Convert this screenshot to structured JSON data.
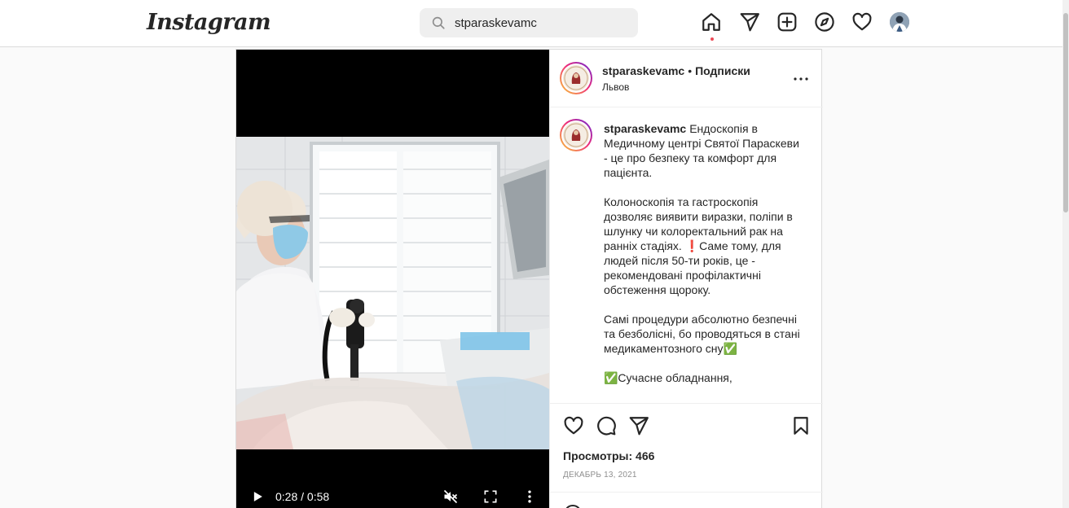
{
  "nav": {
    "logo": "Instagram",
    "search_value": "stparaskevamc",
    "icons": [
      "home-icon",
      "direct-icon",
      "new-post-icon",
      "explore-icon",
      "activity-icon",
      "profile-avatar"
    ]
  },
  "post": {
    "username": "stparaskevamc",
    "separator": "•",
    "follow_label": "Подписки",
    "location": "Львов",
    "caption_text": "Ендоскопія в Медичному центрі Святої Параскеви - це про безпеку та комфорт для пацієнта.\n\nКолоноскопія та гастроскопія дозволяє виявити виразки, поліпи в шлунку чи колоректальний рак на ранніх стадіях. ❗Саме тому, для людей після 50-ти років, це - рекомендовані профілактичні обстеження щороку.\n\nСамі процедури абсолютно безпечні та безболісні, бо проводяться в стані медикаментозного сну✅\n\n✅Сучасне обладнання,",
    "views": "Просмотры: 466",
    "date": "ДЕКАБРЬ 13, 2021"
  },
  "video": {
    "time": "0:28 / 0:58",
    "progress": 0.48
  },
  "colors": {
    "accent": "#ed4956",
    "border": "#dbdbdb",
    "muted": "#8e8e8e"
  }
}
